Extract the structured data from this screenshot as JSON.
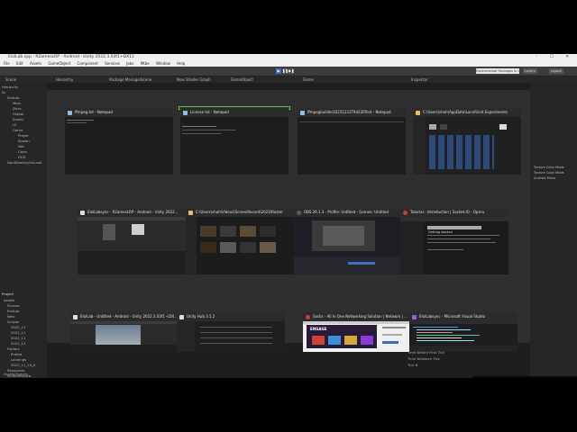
{
  "window": {
    "title": "ElolLab.cpp - R2amesLRP - Android - Unity 2022.3.03f1+DX11",
    "controls": "–  ☐  ✕"
  },
  "menu": [
    "File",
    "Edit",
    "Assets",
    "GameObject",
    "Component",
    "Services",
    "Jobs",
    "Mtbe",
    "Window",
    "Help"
  ],
  "toolbar": {
    "play_icons": [
      "▶",
      "❚❚",
      "▶❚"
    ],
    "banner": "Experimental Packages In Use",
    "layers": "Layers",
    "layout": "Layout"
  },
  "editor_tabs": [
    "Scene",
    "Hierarchy",
    "Package Manager",
    "Scene",
    "New Shader Graph",
    "GameObject",
    "Game",
    "Inspector"
  ],
  "hierarchy_items": [
    "Hierarchy",
    "Sc",
    "+",
    "ElolLab",
    "Main",
    "Direc",
    "Global",
    "Eventi",
    "UI",
    "Game",
    "Player",
    "Spawn",
    "Net",
    "Cana",
    "HUD",
    "DontDestroyOnLoad"
  ],
  "project_items": [
    "Project",
    "+",
    "Assets",
    "Scenes",
    "ElolLab",
    "Netc",
    "Scripts",
    "2022_11",
    "2022_11",
    "2022_11",
    "2022_12",
    "Folders",
    "Prefab",
    "Landings",
    "2022_11_24_0",
    "Resources",
    "ScreenRecord",
    "Sync",
    "Cow",
    "Assets/Assets",
    "Prefabs",
    "Res"
  ],
  "inspector_lines": [
    "Texture Color Mode",
    "Texture Color Mode",
    "Android Mono"
  ],
  "bottom_lines": [
    "Time Before First Tick",
    "Time Between Tick",
    "Tick B"
  ],
  "bottom_left": "Assets/Scenes",
  "task_switcher": [
    {
      "title": "ffmpeg.txt - Notepad",
      "icon_color": "#8ec0e6"
    },
    {
      "title": "License.txt - Notepad",
      "icon_color": "#8ec0e6"
    },
    {
      "title": "ffmpegbuilder20231231T94220Test - Notepad",
      "icon_color": "#8ec0e6"
    },
    {
      "title": "C:\\Users\\shoh\\AppData\\Local\\Unit Experiments",
      "icon_color": "#e8c35a"
    },
    {
      "title": "ElolLabsync - R2amesLRP - Android - Unity 2022...",
      "icon_color": "#dddddd"
    },
    {
      "title": "C:\\Users\\shoh\\Videos\\ScreenRecord\\2023\\Roster",
      "icon_color": "#e8c35a"
    },
    {
      "title": "OBS 29.1.3 - Profile: Untitled - Scenes: Untitled",
      "icon_color": "#5c5c5c"
    },
    {
      "title": "Tutorial - Introduction | Socket.IO - Opera",
      "icon_color": "#d43a3a"
    },
    {
      "title": "ElolLab - Untitled - Android - Unity 2022.3.03f1 <DX...",
      "icon_color": "#dddddd"
    },
    {
      "title": "Unity Hub 3.5.2",
      "icon_color": "#dddddd"
    },
    {
      "title": "Socks - All In One Networking Solution | Network | ...",
      "icon_color": "#d43a3a"
    },
    {
      "title": "ElolLabsync - Microsoft Visual Studio",
      "icon_color": "#9a5fd6"
    }
  ],
  "web_page_text": "Getting started",
  "store_banner": "ENGAGE",
  "colors": {
    "selection_outline": "#6fbf3f",
    "unity_dark": "#1e1e1e",
    "play_blue": "#3a6fc4"
  }
}
